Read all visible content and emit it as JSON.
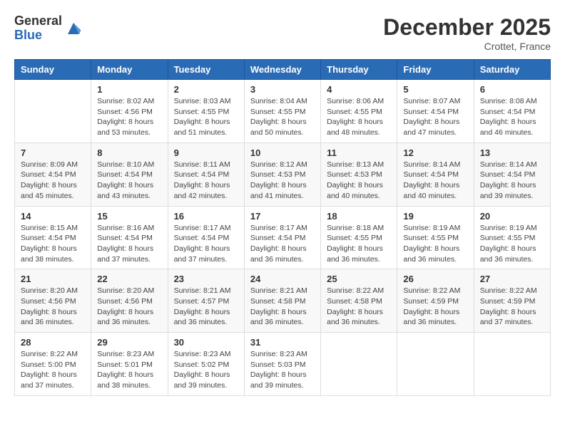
{
  "logo": {
    "general": "General",
    "blue": "Blue"
  },
  "title": "December 2025",
  "location": "Crottet, France",
  "days_of_week": [
    "Sunday",
    "Monday",
    "Tuesday",
    "Wednesday",
    "Thursday",
    "Friday",
    "Saturday"
  ],
  "weeks": [
    [
      {
        "day": "",
        "info": ""
      },
      {
        "day": "1",
        "info": "Sunrise: 8:02 AM\nSunset: 4:56 PM\nDaylight: 8 hours\nand 53 minutes."
      },
      {
        "day": "2",
        "info": "Sunrise: 8:03 AM\nSunset: 4:55 PM\nDaylight: 8 hours\nand 51 minutes."
      },
      {
        "day": "3",
        "info": "Sunrise: 8:04 AM\nSunset: 4:55 PM\nDaylight: 8 hours\nand 50 minutes."
      },
      {
        "day": "4",
        "info": "Sunrise: 8:06 AM\nSunset: 4:55 PM\nDaylight: 8 hours\nand 48 minutes."
      },
      {
        "day": "5",
        "info": "Sunrise: 8:07 AM\nSunset: 4:54 PM\nDaylight: 8 hours\nand 47 minutes."
      },
      {
        "day": "6",
        "info": "Sunrise: 8:08 AM\nSunset: 4:54 PM\nDaylight: 8 hours\nand 46 minutes."
      }
    ],
    [
      {
        "day": "7",
        "info": "Sunrise: 8:09 AM\nSunset: 4:54 PM\nDaylight: 8 hours\nand 45 minutes."
      },
      {
        "day": "8",
        "info": "Sunrise: 8:10 AM\nSunset: 4:54 PM\nDaylight: 8 hours\nand 43 minutes."
      },
      {
        "day": "9",
        "info": "Sunrise: 8:11 AM\nSunset: 4:54 PM\nDaylight: 8 hours\nand 42 minutes."
      },
      {
        "day": "10",
        "info": "Sunrise: 8:12 AM\nSunset: 4:53 PM\nDaylight: 8 hours\nand 41 minutes."
      },
      {
        "day": "11",
        "info": "Sunrise: 8:13 AM\nSunset: 4:53 PM\nDaylight: 8 hours\nand 40 minutes."
      },
      {
        "day": "12",
        "info": "Sunrise: 8:14 AM\nSunset: 4:54 PM\nDaylight: 8 hours\nand 40 minutes."
      },
      {
        "day": "13",
        "info": "Sunrise: 8:14 AM\nSunset: 4:54 PM\nDaylight: 8 hours\nand 39 minutes."
      }
    ],
    [
      {
        "day": "14",
        "info": "Sunrise: 8:15 AM\nSunset: 4:54 PM\nDaylight: 8 hours\nand 38 minutes."
      },
      {
        "day": "15",
        "info": "Sunrise: 8:16 AM\nSunset: 4:54 PM\nDaylight: 8 hours\nand 37 minutes."
      },
      {
        "day": "16",
        "info": "Sunrise: 8:17 AM\nSunset: 4:54 PM\nDaylight: 8 hours\nand 37 minutes."
      },
      {
        "day": "17",
        "info": "Sunrise: 8:17 AM\nSunset: 4:54 PM\nDaylight: 8 hours\nand 36 minutes."
      },
      {
        "day": "18",
        "info": "Sunrise: 8:18 AM\nSunset: 4:55 PM\nDaylight: 8 hours\nand 36 minutes."
      },
      {
        "day": "19",
        "info": "Sunrise: 8:19 AM\nSunset: 4:55 PM\nDaylight: 8 hours\nand 36 minutes."
      },
      {
        "day": "20",
        "info": "Sunrise: 8:19 AM\nSunset: 4:55 PM\nDaylight: 8 hours\nand 36 minutes."
      }
    ],
    [
      {
        "day": "21",
        "info": "Sunrise: 8:20 AM\nSunset: 4:56 PM\nDaylight: 8 hours\nand 36 minutes."
      },
      {
        "day": "22",
        "info": "Sunrise: 8:20 AM\nSunset: 4:56 PM\nDaylight: 8 hours\nand 36 minutes."
      },
      {
        "day": "23",
        "info": "Sunrise: 8:21 AM\nSunset: 4:57 PM\nDaylight: 8 hours\nand 36 minutes."
      },
      {
        "day": "24",
        "info": "Sunrise: 8:21 AM\nSunset: 4:58 PM\nDaylight: 8 hours\nand 36 minutes."
      },
      {
        "day": "25",
        "info": "Sunrise: 8:22 AM\nSunset: 4:58 PM\nDaylight: 8 hours\nand 36 minutes."
      },
      {
        "day": "26",
        "info": "Sunrise: 8:22 AM\nSunset: 4:59 PM\nDaylight: 8 hours\nand 36 minutes."
      },
      {
        "day": "27",
        "info": "Sunrise: 8:22 AM\nSunset: 4:59 PM\nDaylight: 8 hours\nand 37 minutes."
      }
    ],
    [
      {
        "day": "28",
        "info": "Sunrise: 8:22 AM\nSunset: 5:00 PM\nDaylight: 8 hours\nand 37 minutes."
      },
      {
        "day": "29",
        "info": "Sunrise: 8:23 AM\nSunset: 5:01 PM\nDaylight: 8 hours\nand 38 minutes."
      },
      {
        "day": "30",
        "info": "Sunrise: 8:23 AM\nSunset: 5:02 PM\nDaylight: 8 hours\nand 39 minutes."
      },
      {
        "day": "31",
        "info": "Sunrise: 8:23 AM\nSunset: 5:03 PM\nDaylight: 8 hours\nand 39 minutes."
      },
      {
        "day": "",
        "info": ""
      },
      {
        "day": "",
        "info": ""
      },
      {
        "day": "",
        "info": ""
      }
    ]
  ]
}
